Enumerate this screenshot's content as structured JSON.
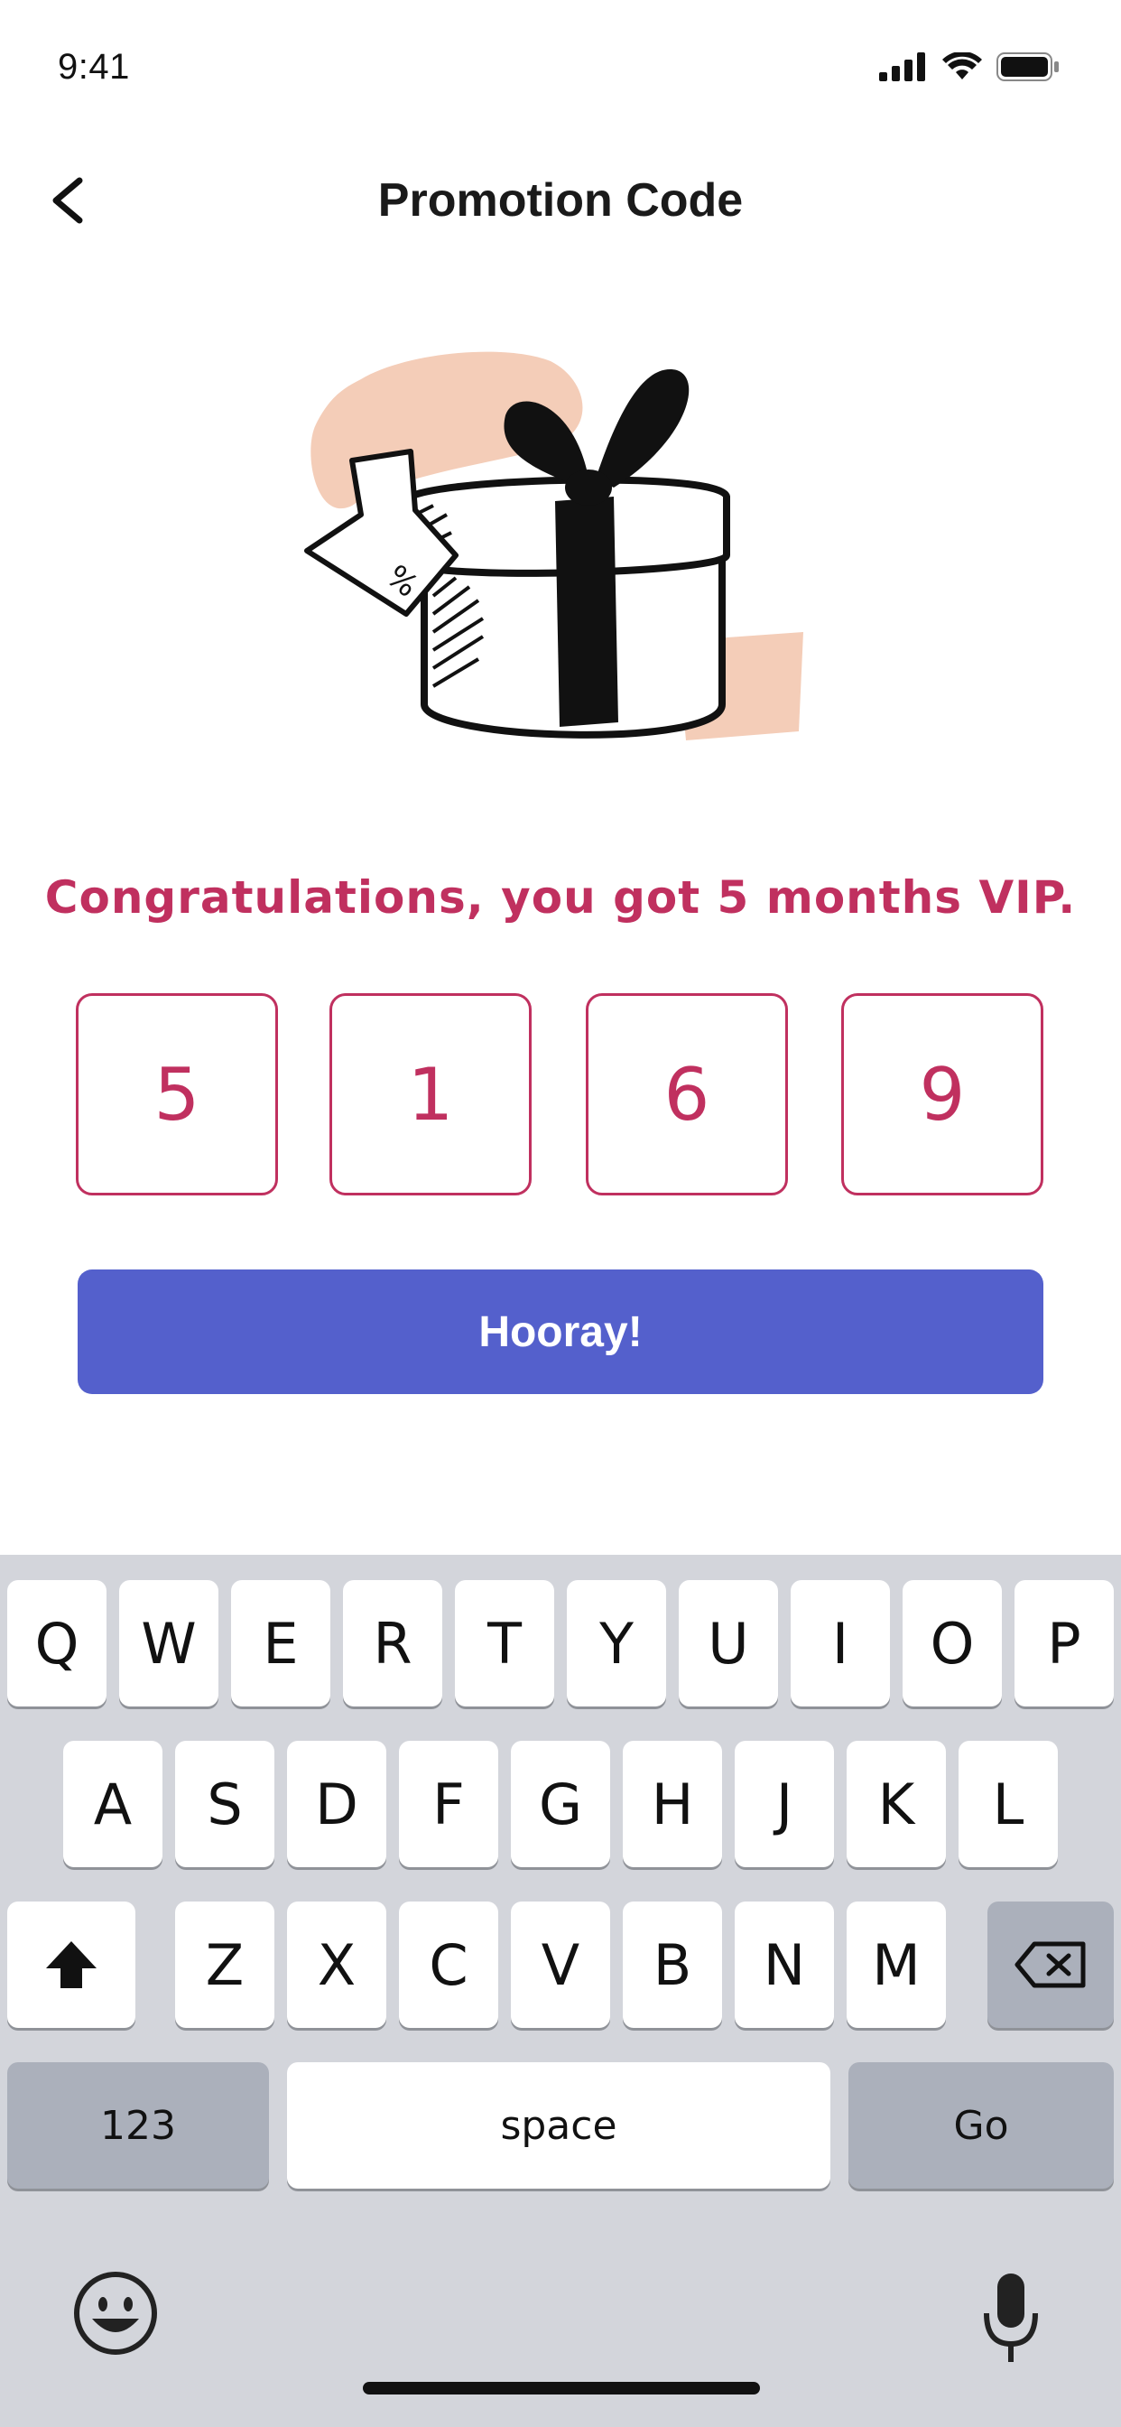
{
  "status_bar": {
    "time": "9:41"
  },
  "nav": {
    "title": "Promotion Code"
  },
  "promo": {
    "message": "Congratulations, you got 5 months VIP.",
    "code_digits": [
      "5",
      "1",
      "6",
      "9"
    ],
    "button_label": "Hooray!"
  },
  "colors": {
    "accent": "#c0305f",
    "button": "#5460cc",
    "keyboard_bg": "#d3d5db",
    "blush": "#f4cdb8"
  },
  "keyboard": {
    "row1": [
      "Q",
      "W",
      "E",
      "R",
      "T",
      "Y",
      "U",
      "I",
      "O",
      "P"
    ],
    "row2": [
      "A",
      "S",
      "D",
      "F",
      "G",
      "H",
      "J",
      "K",
      "L"
    ],
    "row3": [
      "Z",
      "X",
      "C",
      "V",
      "B",
      "N",
      "M"
    ],
    "numbers_label": "123",
    "space_label": "space",
    "go_label": "Go"
  },
  "icons": [
    "back-chevron-icon",
    "signal-icon",
    "wifi-icon",
    "battery-icon",
    "gift-illustration",
    "shift-icon",
    "backspace-icon",
    "emoji-icon",
    "microphone-icon"
  ]
}
